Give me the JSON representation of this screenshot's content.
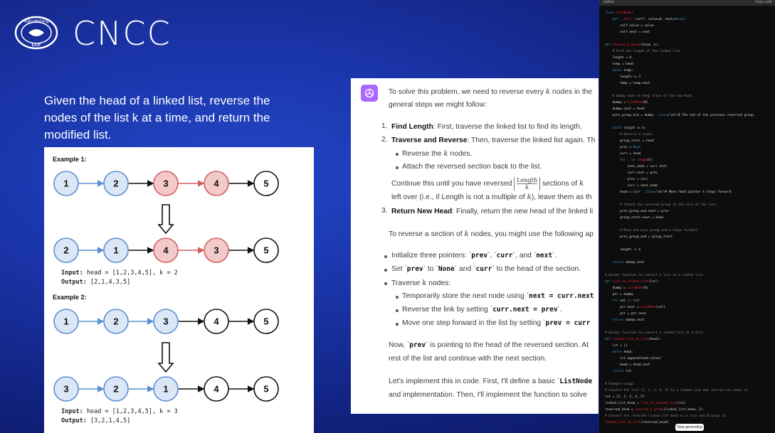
{
  "brand": {
    "name": "CNCC",
    "seal_text_top": "中国计算机学会",
    "seal_text_bottom": "CCF"
  },
  "problem": {
    "lines": [
      "Given the head of a linked list, reverse the",
      "nodes of the list k at a time, and return the",
      "modified list."
    ]
  },
  "examples": {
    "ex1": {
      "title": "Example 1:",
      "before": [
        "1",
        "2",
        "3",
        "4",
        "5"
      ],
      "after": [
        "2",
        "1",
        "4",
        "3",
        "5"
      ],
      "input_label": "Input:",
      "input_value": " head = [1,2,3,4,5], k = 2",
      "output_label": "Output:",
      "output_value": " [2,1,4,3,5]"
    },
    "ex2": {
      "title": "Example 2:",
      "before": [
        "1",
        "2",
        "3",
        "4",
        "5"
      ],
      "after": [
        "3",
        "2",
        "1",
        "4",
        "5"
      ],
      "input_label": "Input:",
      "input_value": " head = [1,2,3,4,5], k = 3",
      "output_label": "Output:",
      "output_value": " [3,2,1,4,5]"
    },
    "colors": {
      "blue_fill": "#dbe7f6",
      "blue_stroke": "#5b8fd1",
      "red_fill": "#f3c9c9",
      "red_stroke": "#d06060",
      "plain_stroke": "#111111"
    }
  },
  "chat": {
    "intro_1": "To solve this problem, we need to reverse every ",
    "intro_k": "k",
    "intro_2": " nodes in the",
    "intro_3": "general steps we might follow:",
    "steps": [
      {
        "num": "1.",
        "bold": "Find Length",
        "rest": ": First, traverse the linked list to find its length."
      },
      {
        "num": "2.",
        "bold": "Traverse and Reverse",
        "rest": ": Then, traverse the linked list again. Th"
      },
      {
        "num": "3.",
        "bold": "Return New Head",
        "rest": ": Finally, return the new head of the linked li"
      }
    ],
    "sub_reverse_1": "Reverse the ",
    "sub_reverse_k": "k",
    "sub_reverse_2": " nodes.",
    "sub_attach": "Attach the reversed section back to the list.",
    "continue_1": "Continue this until you have reversed ",
    "frac_top": "Length",
    "frac_bot": "k",
    "continue_2": " sections of ",
    "continue_k": "k",
    "leftover_1": "left over (i.e., if Length is not a multiple of ",
    "leftover_k": "k",
    "leftover_2": "), leave them as th",
    "reverse_section_1": "To reverse a section of ",
    "reverse_section_k": "k",
    "reverse_section_2": " nodes, you might use the following ap",
    "bullets": {
      "init_1": "Initialize three pointers: `",
      "init_prev": "prev",
      "init_2": "`, `",
      "init_curr": "curr",
      "init_3": "`, and `",
      "init_next": "next",
      "init_4": "`.",
      "set_1": "Set `",
      "set_prev": "prev",
      "set_2": "` to `",
      "set_none": "None",
      "set_3": "` and `",
      "set_curr": "curr",
      "set_4": "` to the head of the section.",
      "traverse_1": "Traverse ",
      "traverse_k": "k",
      "traverse_2": " nodes:",
      "tmp_1": "Temporarily store the next node using `",
      "tmp_code": "next = curr.next",
      "rev_1": "Reverse the link by setting `",
      "rev_code": "curr.next = prev",
      "rev_2": "`.",
      "move_1": "Move one step forward in the list by setting `",
      "move_code": "prev = curr"
    },
    "now_1": "Now, `",
    "now_code": "prev",
    "now_2": "` is pointing to the head of the reversed section. At",
    "now_3": "rest of the list and continue with the next section.",
    "impl_1": "Let's implement this in code. First, I'll define a basic `",
    "impl_code": "ListNode",
    "impl_2": "and implementation. Then, I'll implement the function to solve"
  },
  "code": {
    "lang": "python",
    "copy_label": "Copy code",
    "stop_label": "Stop generating",
    "lines": [
      "class ListNode:",
      "    def __init__(self, value=0, next=None):",
      "        self.value = value",
      "        self.next = next",
      "",
      "def reverse_k_group(head, k):",
      "    # Find the length of the linked list.",
      "    length = 0",
      "    temp = head",
      "    while temp:",
      "        length += 1",
      "        temp = temp.next",
      "",
      "    # Dummy node to keep track of the new head.",
      "    dummy = ListNode(0)",
      "    dummy.next = head",
      "    prev_group_end = dummy  # The end of the previous reversed group.",
      "",
      "    while length >= k:",
      "        # Reverse k nodes.",
      "        group_start = head",
      "        prev = None",
      "        curr = head",
      "        for _ in range(k):",
      "            next_node = curr.next",
      "            curr.next = prev",
      "            prev = curr",
      "            curr = next_node",
      "        head = curr  # Move head pointer k steps forward.",
      "",
      "        # Attach the reversed group to the rest of the list.",
      "        prev_group_end.next = prev",
      "        group_start.next = head",
      "",
      "        # Move the prev_group_end k steps forward.",
      "        prev_group_end = group_start",
      "",
      "        length -= k",
      "",
      "    return dummy.next",
      "",
      "# Helper function to convert a list to a linked list.",
      "def list_to_linked_list(lst):",
      "    dummy = ListNode(0)",
      "    ptr = dummy",
      "    for val in lst:",
      "        ptr.next = ListNode(val)",
      "        ptr = ptr.next",
      "    return dummy.next",
      "",
      "# Helper function to convert a linked list to a list.",
      "def linked_list_to_list(head):",
      "    lst = []",
      "    while head:",
      "        lst.append(head.value)",
      "        head = head.next",
      "    return lst",
      "",
      "# Example usage:",
      "# Convert the list [1, 2, 3, 4, 5] to a linked list and reverse its nodes in",
      "lst = [1, 2, 3, 4, 5]",
      "linked_list_head = list_to_linked_list(lst)",
      "reversed_head = reverse_k_group(linked_list_head, 2)",
      "# Convert the reversed linked list back to a list and display it.",
      "linked_list_to_list(reversed_head)"
    ]
  }
}
